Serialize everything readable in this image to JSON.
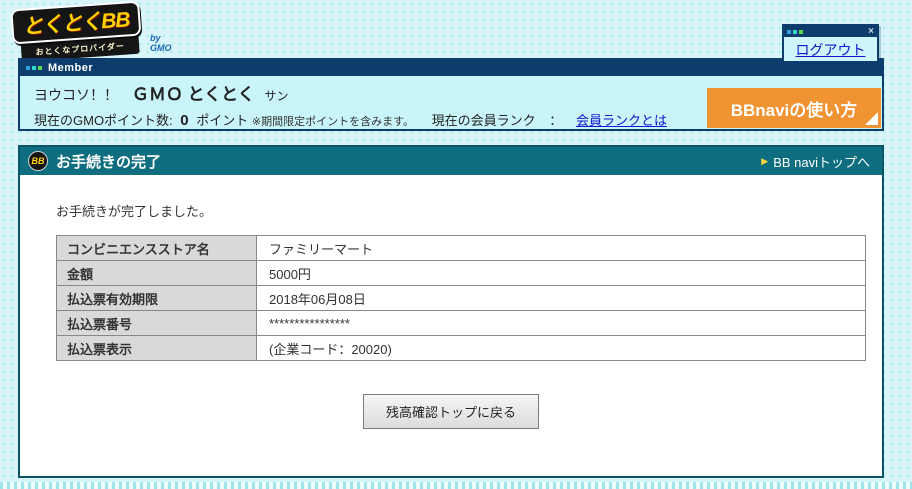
{
  "logo": {
    "title": "とくとくBB",
    "by": "by GMO",
    "tagline": "おとくなプロバイダー"
  },
  "logout_window": {
    "close_icon": "×",
    "link": "ログアウト"
  },
  "member": {
    "bar_label": "Member",
    "welcome_prefix": "ヨウコソ！！",
    "welcome_name": "ＧＭＯ とくとく",
    "welcome_suffix": "サン",
    "points_label": "現在のGMOポイント数:",
    "points_value": "0",
    "points_unit": "ポイント",
    "points_note": "※期間限定ポイントを含みます。",
    "rank_label": "現在の会員ランク",
    "rank_sep": "：",
    "rank_link": "会員ランクとは",
    "bbnavi_button": "BBnaviの使い方"
  },
  "section": {
    "icon": "BB",
    "title": "お手続きの完了",
    "arrow": "▶",
    "top_link": "BB naviトップへ"
  },
  "main": {
    "message": "お手続きが完了しました。",
    "table": {
      "rows": [
        {
          "label": "コンビニエンスストア名",
          "value": "ファミリーマート"
        },
        {
          "label": "金額",
          "value": "5000円"
        },
        {
          "label": "払込票有効期限",
          "value": "2018年06月08日"
        },
        {
          "label": "払込票番号",
          "value": "****************"
        },
        {
          "label": "払込票表示",
          "value": "(企業コード：20020)"
        }
      ]
    },
    "back_button": "残高確認トップに戻る"
  }
}
